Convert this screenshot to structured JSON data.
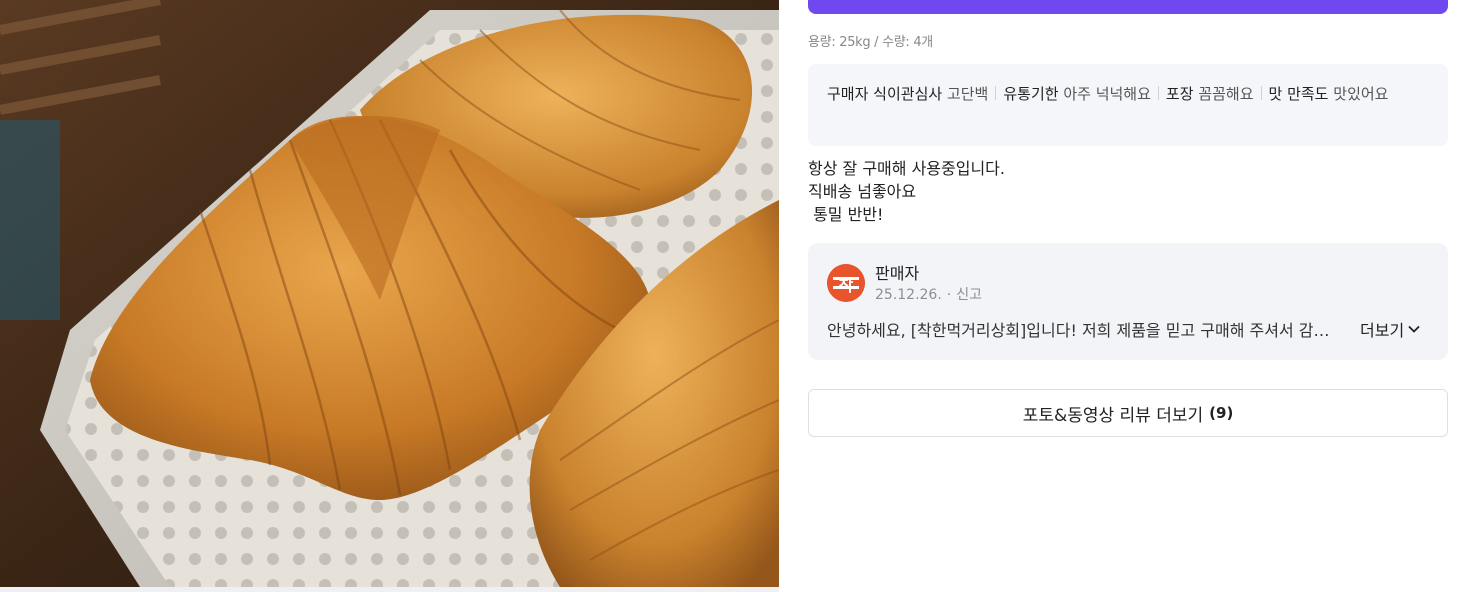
{
  "spec": "용량: 25kg / 수량: 4개",
  "tags": [
    {
      "key": "구매자 식이관심사",
      "value": "고단백"
    },
    {
      "key": "유통기한",
      "value": "아주 넉넉해요"
    },
    {
      "key": "포장",
      "value": "꼼꼼해요"
    },
    {
      "key": "맛 만족도",
      "value": "맛있어요"
    }
  ],
  "review": {
    "line1": "항상 잘 구매해 사용중입니다.",
    "line2": "직배송 넘좋아요",
    "line3": " 통밀 반반!"
  },
  "seller": {
    "name": "판매자",
    "date": "25.12.26.",
    "report": "신고",
    "reply": "안녕하세요, [착한먹거리상회]입니다! 저희 제품을 믿고 구매해 주셔서 감사합니다",
    "more": "더보기",
    "logo_text": "착"
  },
  "photo_more": {
    "label": "포토&동영상 리뷰 더보기",
    "count": "(9)"
  },
  "colors": {
    "accent": "#7048f0",
    "seller_logo": "#e8542b",
    "panel_bg": "#f5f6f9"
  }
}
